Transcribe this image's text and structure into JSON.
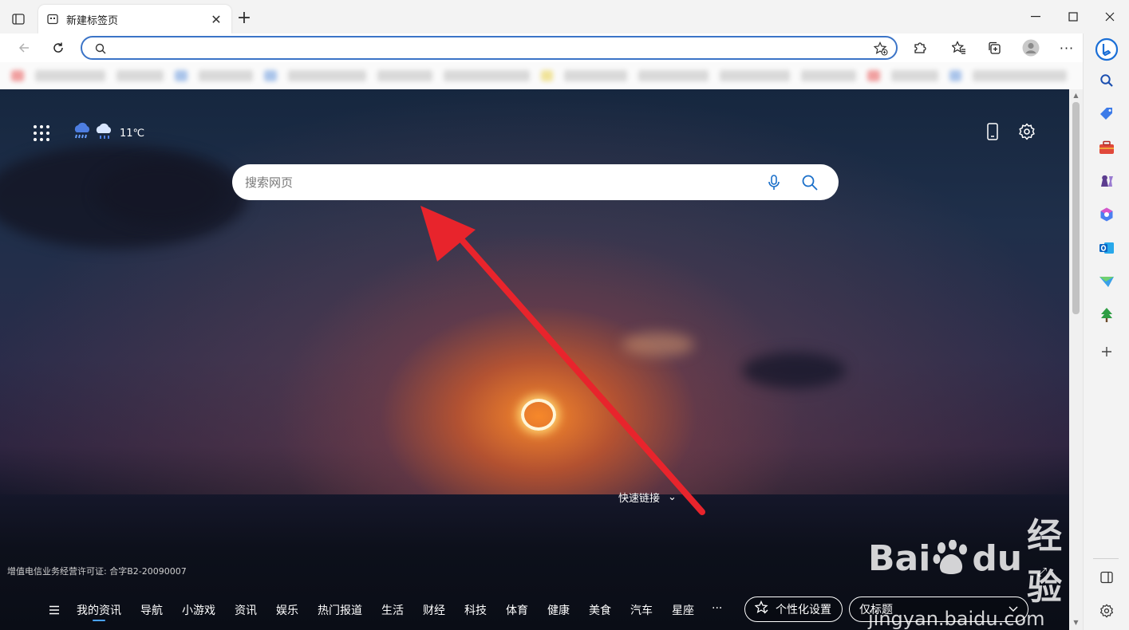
{
  "browser": {
    "tab": {
      "title": "新建标签页",
      "close": "✕"
    },
    "new_tab": "+",
    "window_controls": {
      "minimize": "—",
      "maximize": "☐",
      "close": "✕"
    },
    "address_bar": {
      "value": "",
      "placeholder": ""
    },
    "more": "···"
  },
  "page": {
    "weather": {
      "temperature": "11℃"
    },
    "search": {
      "placeholder": "搜索网页"
    },
    "quick_links": {
      "label": "快速链接",
      "chevron": "⌄"
    },
    "license": "增值电信业务经营许可证: 合字B2-20090007",
    "nav": {
      "items": [
        "我的资讯",
        "导航",
        "小游戏",
        "资讯",
        "娱乐",
        "热门报道",
        "生活",
        "财经",
        "科技",
        "体育",
        "健康",
        "美食",
        "汽车",
        "星座"
      ],
      "more": "···",
      "personalize": "个性化设置",
      "layout": "仅标题"
    },
    "expand": "⤢",
    "watermark": {
      "logo_left": "Bai",
      "logo_mid": "du",
      "logo_right": "经验",
      "url": "jingyan.baidu.com"
    }
  },
  "colors": {
    "accent": "#3b74c7",
    "arrow": "#e8242c",
    "nav_active": "#4aa3ff"
  },
  "icons": {
    "tab_actions": "tab-actions-icon",
    "back": "back-icon",
    "refresh": "refresh-icon",
    "extensions": "puzzle-icon",
    "favorites": "favorites-icon",
    "collections": "collections-icon",
    "profile": "profile-icon",
    "bing": "bing-icon",
    "sidebar": [
      "search-icon",
      "tag-icon",
      "toolbox-icon",
      "games-icon",
      "office-icon",
      "outlook-icon",
      "send-icon",
      "tree-icon",
      "add-icon"
    ]
  }
}
